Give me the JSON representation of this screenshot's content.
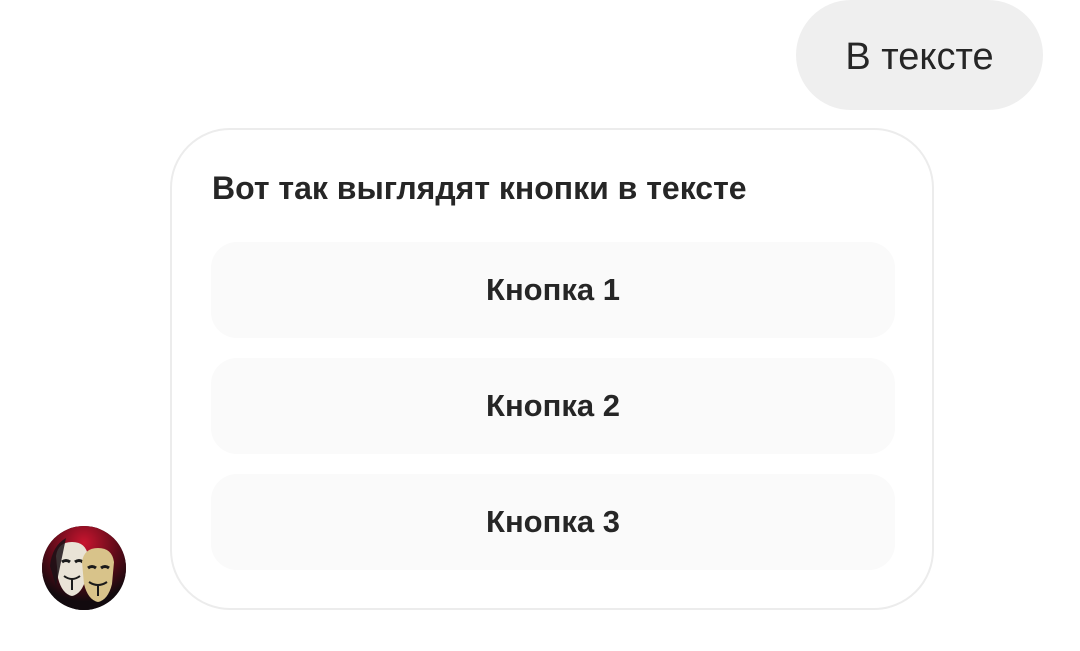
{
  "chat": {
    "user_message": "В тексте",
    "bot_message": {
      "title": "Вот так выглядят кнопки в тексте",
      "buttons": [
        {
          "label": "Кнопка 1"
        },
        {
          "label": "Кнопка 2"
        },
        {
          "label": "Кнопка 3"
        }
      ]
    },
    "bot_avatar": {
      "icon": "guy-fawkes-masks-avatar",
      "accent": "#b0102a"
    }
  },
  "colors": {
    "user_bubble": "#efefef",
    "button_bg": "#fafafa",
    "card_border": "#ececec",
    "text": "#262626"
  }
}
